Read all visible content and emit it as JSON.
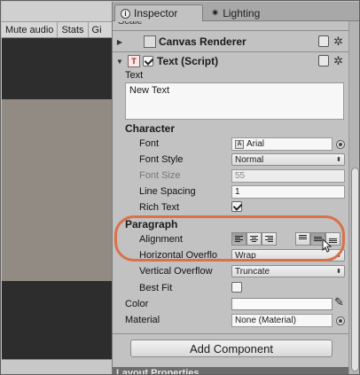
{
  "game_view": {
    "toolbar": [
      "Mute audio",
      "Stats",
      "Gi"
    ]
  },
  "tabs": {
    "inspector": "Inspector",
    "lighting": "Lighting"
  },
  "scale_label": "Scale",
  "canvas_renderer": {
    "title": "Canvas Renderer"
  },
  "text_script": {
    "title": "Text (Script)",
    "enabled": true,
    "text_label": "Text",
    "text_value": "New Text"
  },
  "character": {
    "heading": "Character",
    "font_label": "Font",
    "font_value": "Arial",
    "font_style_label": "Font Style",
    "font_style_value": "Normal",
    "font_size_label": "Font Size",
    "font_size_value": "55",
    "line_spacing_label": "Line Spacing",
    "line_spacing_value": "1",
    "rich_text_label": "Rich Text",
    "rich_text_checked": true
  },
  "paragraph": {
    "heading": "Paragraph",
    "alignment_label": "Alignment",
    "h_overflow_label": "Horizontal Overflo",
    "h_overflow_value": "Wrap",
    "v_overflow_label": "Vertical Overflow",
    "v_overflow_value": "Truncate",
    "best_fit_label": "Best Fit",
    "best_fit_checked": false
  },
  "color_label": "Color",
  "material_label": "Material",
  "material_value": "None (Material)",
  "add_component": "Add Component",
  "layout_properties": "Layout Properties",
  "colors": {
    "highlight": "#d9714b",
    "canvas_gray": "#928b84"
  }
}
